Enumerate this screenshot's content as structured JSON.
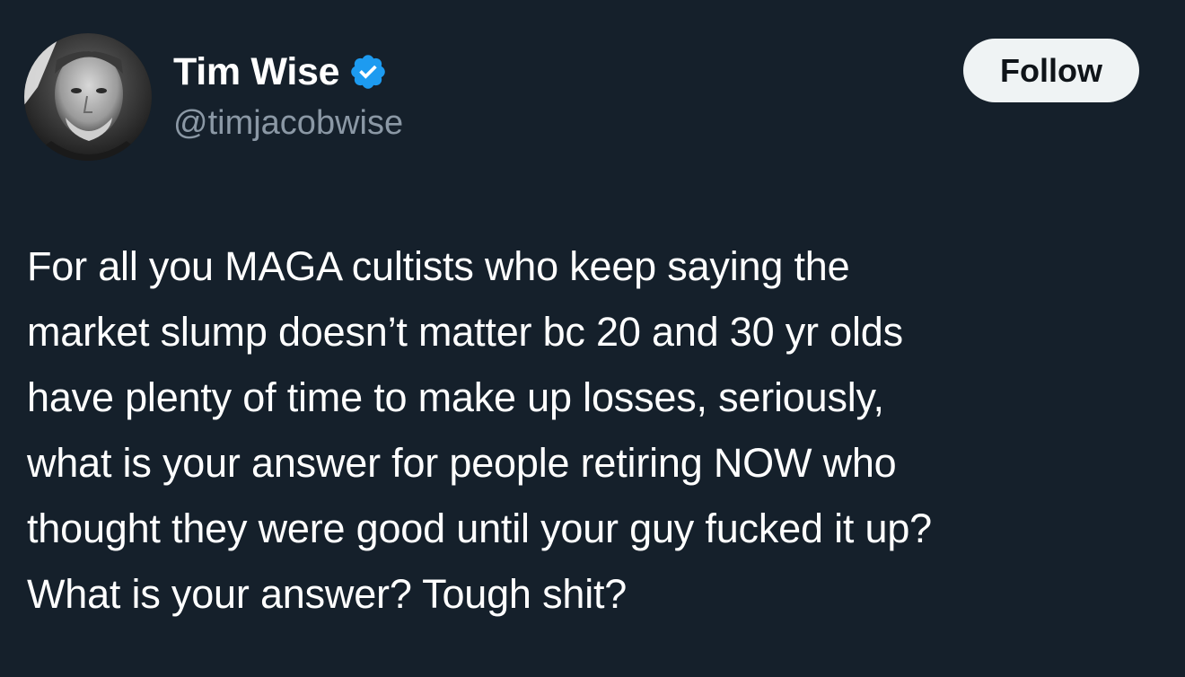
{
  "author": {
    "display_name": "Tim Wise",
    "handle": "@timjacobwise",
    "verified": true
  },
  "follow_button": {
    "label": "Follow"
  },
  "tweet": {
    "text": "For all you MAGA cultists who keep saying the\nmarket slump doesn’t matter bc 20 and 30 yr olds\nhave plenty of time to make up losses, seriously,\nwhat is your answer for people retiring NOW who\nthought they were good until your guy fucked it up?\nWhat is your answer? Tough shit?"
  },
  "colors": {
    "background": "#15202b",
    "text": "#ffffff",
    "secondary_text": "#8b98a5",
    "verified_badge": "#1d9bf0",
    "follow_button_bg": "#eff3f4",
    "follow_button_text": "#0f1419"
  },
  "icons": {
    "verified": "verified-badge-icon"
  }
}
